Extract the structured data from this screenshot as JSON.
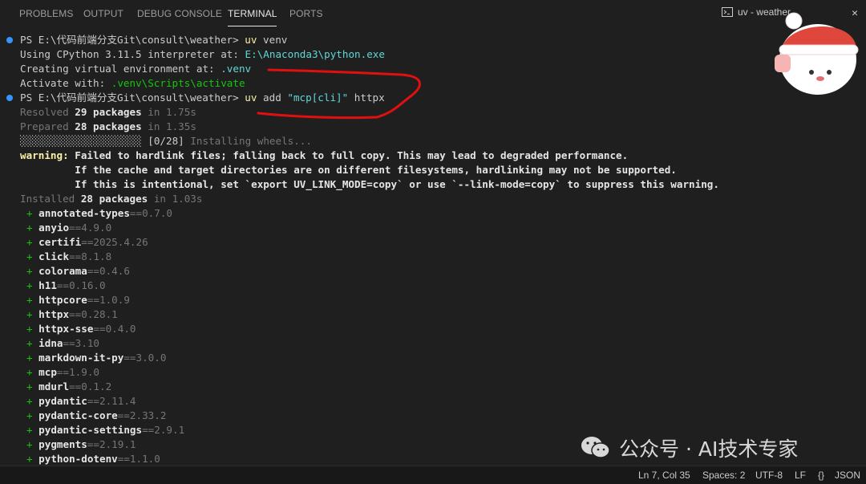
{
  "panel_tabs": [
    "PROBLEMS",
    "OUTPUT",
    "DEBUG CONSOLE",
    "TERMINAL",
    "PORTS"
  ],
  "active_tab": "TERMINAL",
  "terminal_tab_label": "uv - weather",
  "prompt": "PS E:\\代码前端分支Git\\consult\\weather>",
  "cmd1": {
    "prog": "uv",
    "args": " venv"
  },
  "using_text": "Using CPython 3.11.5 interpreter at: ",
  "interpreter_path": "E:\\Anaconda3\\python.exe",
  "creating_text": "Creating virtual environment at: ",
  "venv_path": ".venv",
  "activate_text": "Activate with: ",
  "activate_cmd": ".venv\\Scripts\\activate",
  "cmd2": {
    "prog": "uv",
    "mid": " add ",
    "arg": "\"mcp[cli]\"",
    "rest": " httpx"
  },
  "resolved": {
    "pre": "Resolved ",
    "count": "29 packages",
    "post": " in 1.75s"
  },
  "prepared": {
    "pre": "Prepared ",
    "count": "28 packages",
    "post": " in 1.35s"
  },
  "progress": {
    "bar": "░░░░░░░░░░░░░░░░░░░░",
    "count": "[0/28]",
    "label": " Installing wheels..."
  },
  "warning": {
    "label": "warning:",
    "lines": [
      " Failed to hardlink files; falling back to full copy. This may lead to degraded performance.",
      "         If the cache and target directories are on different filesystems, hardlinking may not be supported.",
      "         If this is intentional, set `export UV_LINK_MODE=copy` or use `--link-mode=copy` to suppress this warning."
    ]
  },
  "installed": {
    "pre": "Installed ",
    "count": "28 packages",
    "post": " in 1.03s"
  },
  "packages": [
    {
      "name": "annotated-types",
      "version": "==0.7.0"
    },
    {
      "name": "anyio",
      "version": "==4.9.0"
    },
    {
      "name": "certifi",
      "version": "==2025.4.26"
    },
    {
      "name": "click",
      "version": "==8.1.8"
    },
    {
      "name": "colorama",
      "version": "==0.4.6"
    },
    {
      "name": "h11",
      "version": "==0.16.0"
    },
    {
      "name": "httpcore",
      "version": "==1.0.9"
    },
    {
      "name": "httpx",
      "version": "==0.28.1"
    },
    {
      "name": "httpx-sse",
      "version": "==0.4.0"
    },
    {
      "name": "idna",
      "version": "==3.10"
    },
    {
      "name": "markdown-it-py",
      "version": "==3.0.0"
    },
    {
      "name": "mcp",
      "version": "==1.9.0"
    },
    {
      "name": "mdurl",
      "version": "==0.1.2"
    },
    {
      "name": "pydantic",
      "version": "==2.11.4"
    },
    {
      "name": "pydantic-core",
      "version": "==2.33.2"
    },
    {
      "name": "pydantic-settings",
      "version": "==2.9.1"
    },
    {
      "name": "pygments",
      "version": "==2.19.1"
    },
    {
      "name": "python-dotenv",
      "version": "==1.1.0"
    }
  ],
  "status_bar": {
    "position": "Ln 7, Col 35",
    "spaces": "Spaces: 2",
    "encoding": "UTF-8",
    "eol": "LF",
    "language_icon": "{}",
    "language": "JSON"
  },
  "watermark": "公众号 · AI技术专家",
  "colors": {
    "background": "#1f1f1f",
    "accent_blue": "#3794ff",
    "prompt_command": "#f9f1a5",
    "path_cyan": "#61d6d6",
    "success_green": "#16c60c",
    "annotation_red": "#e01010"
  }
}
